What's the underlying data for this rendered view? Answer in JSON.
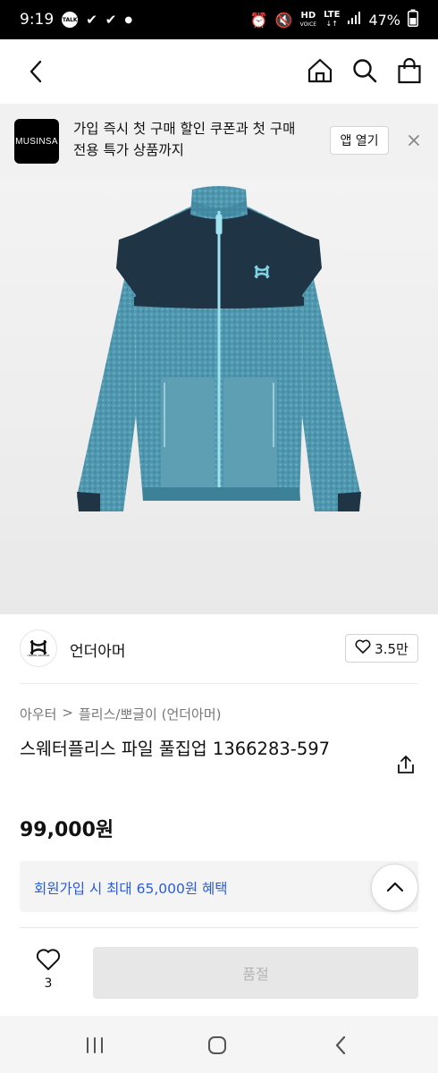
{
  "status_bar": {
    "time": "9:19",
    "notif_talk": "TALK",
    "hd_label": "HD",
    "voice_label": "VOICE",
    "lte_label": "LTE",
    "battery": "47%"
  },
  "nav": {
    "back_icon": "chevron-left-icon",
    "home_icon": "home-icon",
    "search_icon": "search-icon",
    "bag_icon": "bag-icon"
  },
  "banner": {
    "logo_text": "MUSINSA",
    "line1": "가입 즉시 첫 구매 할인 쿠폰과 첫 구매",
    "line2": "전용 특가 상품까지",
    "open_label": "앱 열기"
  },
  "brand": {
    "name": "언더아머",
    "likes": "3.5만"
  },
  "product": {
    "breadcrumb_category": "아우터",
    "breadcrumb_separator": ">",
    "breadcrumb_sub": "플리스/뽀글이 (언더아머)",
    "title": "스웨터플리스 파일 풀집업 1366283-597",
    "price": "99,000원",
    "benefit": "회원가입 시 최대 65,000원 혜택"
  },
  "bottom": {
    "wish_count": "3",
    "soldout_label": "품절"
  },
  "colors": {
    "accent_blue": "#2b5bd7",
    "jacket_teal": "#4f97ae",
    "jacket_navy": "#1f3546"
  }
}
